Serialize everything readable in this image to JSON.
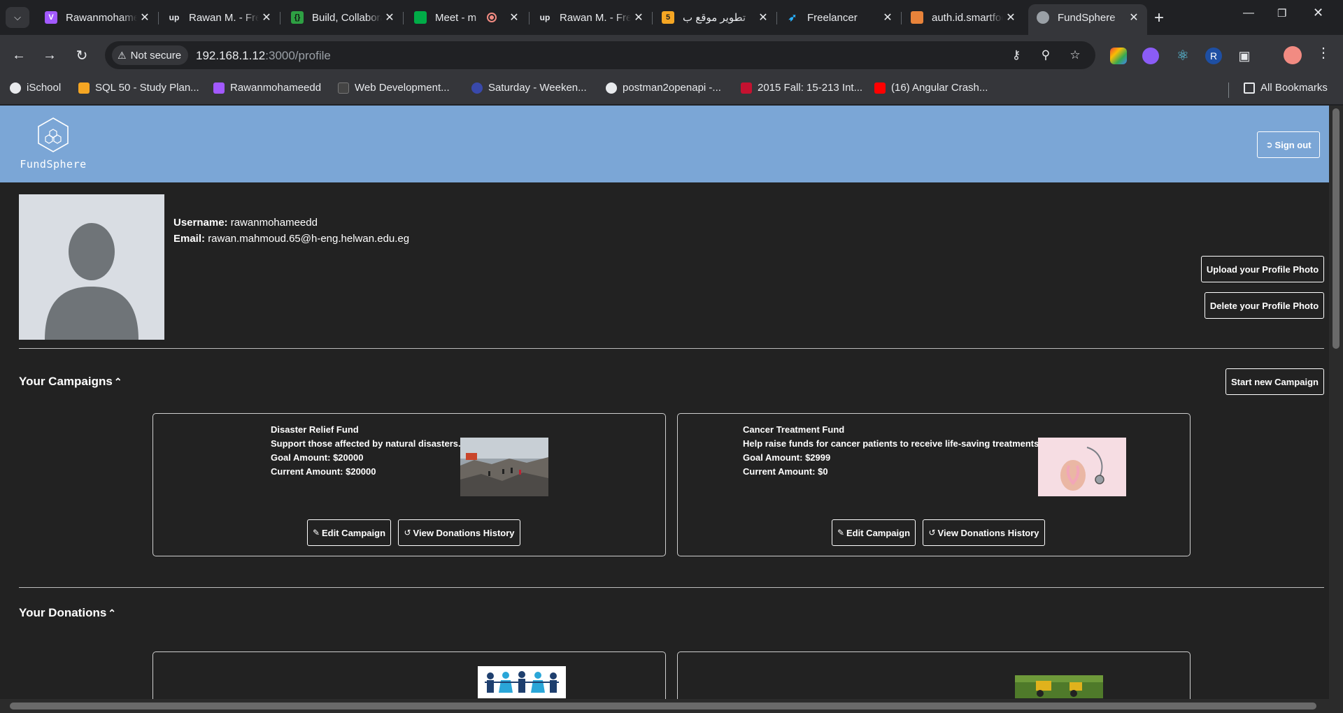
{
  "browser": {
    "tabs": [
      {
        "title": "Rawanmohameedd",
        "icon": "vite-icon",
        "color": "#a259ff"
      },
      {
        "title": "Rawan M. - Freelancer",
        "icon": "upwork-icon",
        "color": "#14a800"
      },
      {
        "title": "Build, Collaborate",
        "icon": "braces-icon",
        "color": "#2ea043"
      },
      {
        "title": "Meet - m",
        "icon": "meet-icon",
        "color": "#00ac47"
      },
      {
        "title": "Rawan M. - Freelancer",
        "icon": "upwork-icon",
        "color": "#14a800"
      },
      {
        "title": "تطوير موقع ب",
        "icon": "khamsat-icon",
        "color": "#f5a623"
      },
      {
        "title": "Freelancer",
        "icon": "freelancer-icon",
        "color": "#29b2fe"
      },
      {
        "title": "auth.id.smartfoods",
        "icon": "gamepad-icon",
        "color": "#e8833a"
      },
      {
        "title": "FundSphere",
        "icon": "fundsphere-icon",
        "color": "#9aa0a6"
      }
    ],
    "security_label": "Not secure",
    "url_host": "192.168.1.12",
    "url_rest": ":3000/profile",
    "bookmarks": [
      {
        "label": "iSchool",
        "color": "#e8eaed"
      },
      {
        "label": "SQL 50 - Study Plan...",
        "color": "#f5a623"
      },
      {
        "label": "Rawanmohameedd",
        "color": "#a259ff"
      },
      {
        "label": "Web Development...",
        "color": "#444"
      },
      {
        "label": "Saturday - Weeken...",
        "color": "#3949ab"
      },
      {
        "label": "postman2openapi -...",
        "color": "#e8eaed"
      },
      {
        "label": "2015 Fall: 15-213 Int...",
        "color": "#c41230"
      },
      {
        "label": "(16) Angular Crash...",
        "color": "#ff0000"
      }
    ],
    "all_bookmarks_label": "All Bookmarks"
  },
  "header": {
    "logo_text": "FundSphere",
    "sign_out_label": "Sign out",
    "color": "#7ba6d6"
  },
  "profile": {
    "username_label": "Username:",
    "username": "rawanmohameedd",
    "email_label": "Email:",
    "email": "rawan.mahmoud.65@h-eng.helwan.edu.eg",
    "upload_label": "Upload your Profile Photo",
    "delete_label": "Delete your Profile Photo"
  },
  "campaigns_section": {
    "title": "Your Campaigns",
    "start_label": "Start new Campaign",
    "cards": [
      {
        "title": "Disaster Relief Fund",
        "description": "Support those affected by natural disasters.",
        "goal": "Goal Amount: $20000",
        "current": "Current Amount: $20000",
        "image": "rubble-photo",
        "edit_label": "Edit Campaign",
        "history_label": "View Donations History"
      },
      {
        "title": "Cancer Treatment Fund",
        "description": "Help raise funds for cancer patients to receive life-saving treatments.",
        "goal": "Goal Amount: $2999",
        "current": "Current Amount: $0",
        "image": "ribbon-stethoscope-photo",
        "edit_label": "Edit Campaign",
        "history_label": "View Donations History"
      }
    ]
  },
  "donations_section": {
    "title": "Your Donations",
    "cards": [
      {
        "image": "children-silhouettes-image"
      },
      {
        "image": "tractor-field-photo"
      }
    ]
  }
}
